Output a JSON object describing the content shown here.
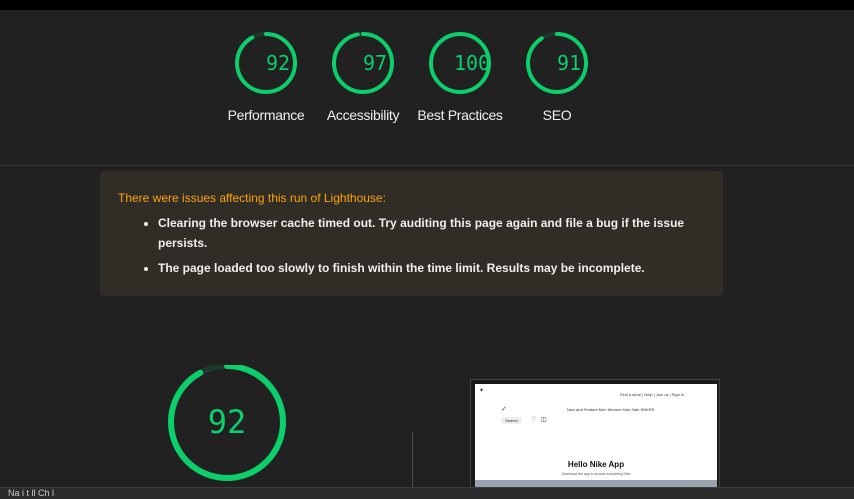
{
  "gauges": [
    {
      "score": "92",
      "label": "Performance",
      "value": 92,
      "color": "#0cce6b"
    },
    {
      "score": "97",
      "label": "Accessibility",
      "value": 97,
      "color": "#0cce6b"
    },
    {
      "score": "100",
      "label": "Best Practices",
      "value": 100,
      "color": "#0cce6b"
    },
    {
      "score": "91",
      "label": "SEO",
      "value": 91,
      "color": "#0cce6b"
    }
  ],
  "warning": {
    "title": "There were issues affecting this run of Lighthouse:",
    "items": [
      "Clearing the browser cache timed out. Try auditing this page again and file a bug if the issue persists.",
      "The page loaded too slowly to finish within the time limit. Results may be incomplete."
    ],
    "title_color": "#ffa400"
  },
  "main_gauge": {
    "score": "92",
    "value": 92,
    "color": "#0cce6b"
  },
  "screenshot": {
    "nav_links": "Find a store | Help | Join us | Sign In",
    "search": "Search",
    "menu": "New and Feature Men Women Kids Sale SNKRS",
    "headline": "Hello Nike App",
    "subtext": "Download the app to access everything Nike"
  },
  "bottom_bar": {
    "text": "Na   i t       ll        Ch                     l"
  }
}
